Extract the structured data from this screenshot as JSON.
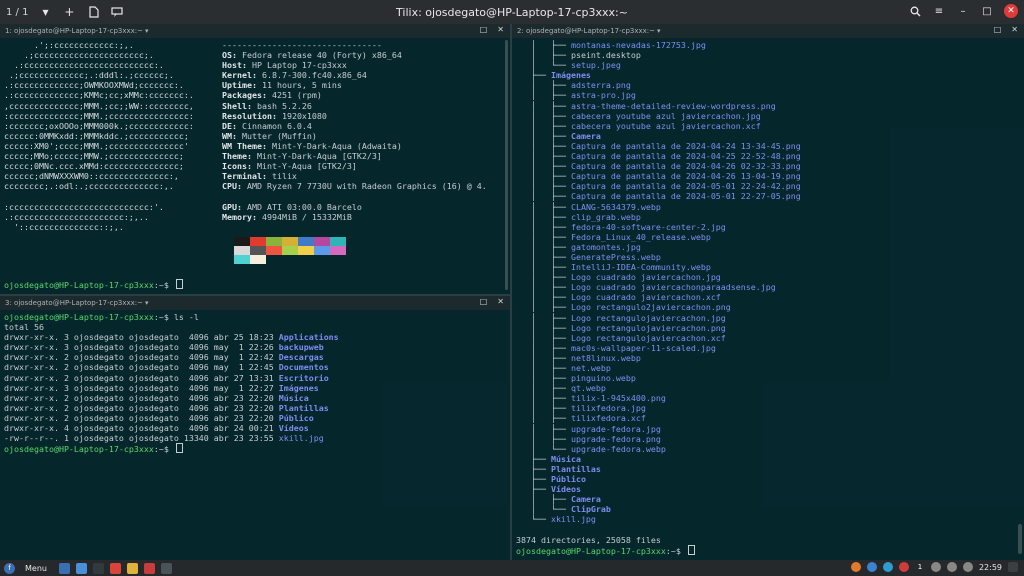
{
  "titlebar": {
    "session": "1 / 1",
    "title": "Tilix: ojosdegato@HP-Laptop-17-cp3xxx:~",
    "icons": [
      "chevron-down-icon",
      "add-terminal-icon",
      "new-session-icon",
      "notification-icon",
      "search-icon",
      "hamburger-menu-icon",
      "minimize-icon",
      "maximize-icon",
      "close-icon"
    ]
  },
  "panes": {
    "top_left": {
      "title": "1: ojosdegato@HP-Laptop-17-cp3xxx:~",
      "logo_lines": [
        "      .';:cccccccccccc:;,.       ",
        "    .;cccccccccccccccccccccc;.   ",
        "  .:cccccccccccccccccccccccccc:. ",
        " .;ccccccccccccc;.:dddl:.;cccccc;.",
        ".:ccccccccccccc;OWMKOOXMWd;ccccccc:.",
        ".:ccccccccccccc;KMMc;cc;xMMc:ccccccc:.",
        ",cccccccccccccc;MMM.;cc;;WW::cccccccc,",
        ":cccccccccccccc;MMM.;cccccccccccccccc:",
        ":ccccccc;oxOOOo;MMM000k.;cccccccccccc:",
        "cccccc:0MMKxdd:;MMMkddc.;ccccccccccc;",
        "ccccc:XM0';cccc;MMM.;ccccccccccccccc'",
        "ccccc;MMo;ccccc;MMW.;cccccccccccccc;",
        "ccccc;0MNc.ccc.xMMd:ccccccccccccccc;",
        "cccccc;dNMWXXXWM0::cccccccccccccc:,",
        "cccccccc;.:odl:.;cccccccccccccc:,.",
        "",
        ":cccccccccccccccccccccccccccc:'.",
        ".:cccccccccccccccccccccc:;,..",
        "  '::cccccccccccccc::;,."
      ],
      "info": [
        {
          "label": "",
          "value": "--------------------------------"
        },
        {
          "label": "OS",
          "value": "Fedora release 40 (Forty) x86_64"
        },
        {
          "label": "Host",
          "value": "HP Laptop 17-cp3xxx"
        },
        {
          "label": "Kernel",
          "value": "6.8.7-300.fc40.x86_64"
        },
        {
          "label": "Uptime",
          "value": "11 hours, 5 mins"
        },
        {
          "label": "Packages",
          "value": "4251 (rpm)"
        },
        {
          "label": "Shell",
          "value": "bash 5.2.26"
        },
        {
          "label": "Resolution",
          "value": "1920x1080"
        },
        {
          "label": "DE",
          "value": "Cinnamon 6.0.4"
        },
        {
          "label": "WM",
          "value": "Mutter (Muffin)"
        },
        {
          "label": "WM Theme",
          "value": "Mint-Y-Dark-Aqua (Adwaita)"
        },
        {
          "label": "Theme",
          "value": "Mint-Y-Dark-Aqua [GTK2/3]"
        },
        {
          "label": "Icons",
          "value": "Mint-Y-Aqua [GTK2/3]"
        },
        {
          "label": "Terminal",
          "value": "tilix"
        },
        {
          "label": "CPU",
          "value": "AMD Ryzen 7 7730U with Radeon Graphics (16) @ 4."
        },
        {
          "label": "",
          "value": ""
        },
        {
          "label": "GPU",
          "value": "AMD ATI 03:00.0 Barcelo"
        },
        {
          "label": "Memory",
          "value": "4994MiB / 15332MiB"
        }
      ],
      "swatch_colors": [
        "#1a1a1a",
        "#e03b2e",
        "#8ab33a",
        "#d6b032",
        "#3e7cc9",
        "#b5479e",
        "#2eb5b5",
        "#d9d9d9",
        "#555555",
        "#f0533f",
        "#a6d04a",
        "#f2cf4b",
        "#5b9bea",
        "#d46ac0",
        "#4fd2d2",
        "#f5f0dc"
      ],
      "prompt_user": "ojosdegato@HP-Laptop-17-cp3xxx",
      "prompt_suffix": ":~$ "
    },
    "bottom_left": {
      "title": "3: ojosdegato@HP-Laptop-17-cp3xxx:~",
      "prompt_user": "ojosdegato@HP-Laptop-17-cp3xxx",
      "prompt_suffix": ":~$ ",
      "command": "ls -l",
      "total": "total 56",
      "rows": [
        {
          "meta": "drwxr-xr-x. 3 ojosdegato ojosdegato  4096 abr 25 18:23 ",
          "name": "Applications",
          "dir": true
        },
        {
          "meta": "drwxr-xr-x. 3 ojosdegato ojosdegato  4096 may  1 22:26 ",
          "name": "backupweb",
          "dir": true
        },
        {
          "meta": "drwxr-xr-x. 2 ojosdegato ojosdegato  4096 may  1 22:42 ",
          "name": "Descargas",
          "dir": true
        },
        {
          "meta": "drwxr-xr-x. 2 ojosdegato ojosdegato  4096 may  1 22:45 ",
          "name": "Documentos",
          "dir": true
        },
        {
          "meta": "drwxr-xr-x. 2 ojosdegato ojosdegato  4096 abr 27 13:31 ",
          "name": "Escritorio",
          "dir": true
        },
        {
          "meta": "drwxr-xr-x. 3 ojosdegato ojosdegato  4096 may  1 22:27 ",
          "name": "Imágenes",
          "dir": true
        },
        {
          "meta": "drwxr-xr-x. 2 ojosdegato ojosdegato  4096 abr 23 22:20 ",
          "name": "Música",
          "dir": true
        },
        {
          "meta": "drwxr-xr-x. 2 ojosdegato ojosdegato  4096 abr 23 22:20 ",
          "name": "Plantillas",
          "dir": true
        },
        {
          "meta": "drwxr-xr-x. 2 ojosdegato ojosdegato  4096 abr 23 22:20 ",
          "name": "Público",
          "dir": true
        },
        {
          "meta": "drwxr-xr-x. 4 ojosdegato ojosdegato  4096 abr 24 00:21 ",
          "name": "Vídeos",
          "dir": true
        },
        {
          "meta": "-rw-r--r--. 1 ojosdegato ojosdegato 13340 abr 23 23:55 ",
          "name": "xkill.jpg",
          "dir": false
        }
      ]
    },
    "right": {
      "title": "2: ojosdegato@HP-Laptop-17-cp3xxx:~",
      "tree": [
        {
          "prefix": "   │   ├── ",
          "name": "montanas-nevadas-172753.jpg",
          "kind": "file"
        },
        {
          "prefix": "   │   ├── ",
          "name": "pseint.desktop",
          "kind": "plain"
        },
        {
          "prefix": "   │   └── ",
          "name": "setup.jpeg",
          "kind": "file"
        },
        {
          "prefix": "   ├── ",
          "name": "Imágenes",
          "kind": "dir"
        },
        {
          "prefix": "   │   ├── ",
          "name": "adsterra.png",
          "kind": "file"
        },
        {
          "prefix": "   │   ├── ",
          "name": "astra-pro.jpg",
          "kind": "file"
        },
        {
          "prefix": "   │   ├── ",
          "name": "astra-theme-detailed-review-wordpress.png",
          "kind": "file"
        },
        {
          "prefix": "   │   ├── ",
          "name": "cabecera youtube azul javiercachon.jpg",
          "kind": "file"
        },
        {
          "prefix": "   │   ├── ",
          "name": "cabecera youtube azul javiercachon.xcf",
          "kind": "file"
        },
        {
          "prefix": "   │   ├── ",
          "name": "Camera",
          "kind": "dir"
        },
        {
          "prefix": "   │   ├── ",
          "name": "Captura de pantalla de 2024-04-24 13-34-45.png",
          "kind": "file"
        },
        {
          "prefix": "   │   ├── ",
          "name": "Captura de pantalla de 2024-04-25 22-52-48.png",
          "kind": "file"
        },
        {
          "prefix": "   │   ├── ",
          "name": "Captura de pantalla de 2024-04-26 02-32-33.png",
          "kind": "file"
        },
        {
          "prefix": "   │   ├── ",
          "name": "Captura de pantalla de 2024-04-26 13-04-19.png",
          "kind": "file"
        },
        {
          "prefix": "   │   ├── ",
          "name": "Captura de pantalla de 2024-05-01 22-24-42.png",
          "kind": "file"
        },
        {
          "prefix": "   │   ├── ",
          "name": "Captura de pantalla de 2024-05-01 22-27-05.png",
          "kind": "file"
        },
        {
          "prefix": "   │   ├── ",
          "name": "CLANG-5634379.webp",
          "kind": "file"
        },
        {
          "prefix": "   │   ├── ",
          "name": "clip_grab.webp",
          "kind": "file"
        },
        {
          "prefix": "   │   ├── ",
          "name": "fedora-40-software-center-2.jpg",
          "kind": "file"
        },
        {
          "prefix": "   │   ├── ",
          "name": "Fedora_Linux_40_release.webp",
          "kind": "file"
        },
        {
          "prefix": "   │   ├── ",
          "name": "gatomontes.jpg",
          "kind": "file"
        },
        {
          "prefix": "   │   ├── ",
          "name": "GeneratePress.webp",
          "kind": "file"
        },
        {
          "prefix": "   │   ├── ",
          "name": "IntelliJ-IDEA-Community.webp",
          "kind": "file"
        },
        {
          "prefix": "   │   ├── ",
          "name": "Logo cuadrado javiercachon.jpg",
          "kind": "file"
        },
        {
          "prefix": "   │   ├── ",
          "name": "Logo cuadrado javiercachonparaadsense.jpg",
          "kind": "file"
        },
        {
          "prefix": "   │   ├── ",
          "name": "Logo cuadrado javiercachon.xcf",
          "kind": "file"
        },
        {
          "prefix": "   │   ├── ",
          "name": "Logo rectangulo2javiercachon.png",
          "kind": "file"
        },
        {
          "prefix": "   │   ├── ",
          "name": "Logo rectangulojaviercachon.jpg",
          "kind": "file"
        },
        {
          "prefix": "   │   ├── ",
          "name": "Logo rectangulojaviercachon.png",
          "kind": "file"
        },
        {
          "prefix": "   │   ├── ",
          "name": "Logo rectangulojaviercachon.xcf",
          "kind": "file"
        },
        {
          "prefix": "   │   ├── ",
          "name": "mac0s-wallpaper-11-scaled.jpg",
          "kind": "file"
        },
        {
          "prefix": "   │   ├── ",
          "name": "net8linux.webp",
          "kind": "file"
        },
        {
          "prefix": "   │   ├── ",
          "name": "net.webp",
          "kind": "file"
        },
        {
          "prefix": "   │   ├── ",
          "name": "pinguino.webp",
          "kind": "file"
        },
        {
          "prefix": "   │   ├── ",
          "name": "qt.webp",
          "kind": "file"
        },
        {
          "prefix": "   │   ├── ",
          "name": "tilix-1-945x400.png",
          "kind": "file"
        },
        {
          "prefix": "   │   ├── ",
          "name": "tilixfedora.jpg",
          "kind": "file"
        },
        {
          "prefix": "   │   ├── ",
          "name": "tilixfedora.xcf",
          "kind": "file"
        },
        {
          "prefix": "   │   ├── ",
          "name": "upgrade-fedora.jpg",
          "kind": "file"
        },
        {
          "prefix": "   │   ├── ",
          "name": "upgrade-fedora.png",
          "kind": "file"
        },
        {
          "prefix": "   │   └── ",
          "name": "upgrade-fedora.webp",
          "kind": "file"
        },
        {
          "prefix": "   ├── ",
          "name": "Música",
          "kind": "dir"
        },
        {
          "prefix": "   ├── ",
          "name": "Plantillas",
          "kind": "dir"
        },
        {
          "prefix": "   ├── ",
          "name": "Público",
          "kind": "dir"
        },
        {
          "prefix": "   ├── ",
          "name": "Vídeos",
          "kind": "dir"
        },
        {
          "prefix": "   │   ├── ",
          "name": "Camera",
          "kind": "dir"
        },
        {
          "prefix": "   │   └── ",
          "name": "ClipGrab",
          "kind": "dir"
        },
        {
          "prefix": "   └── ",
          "name": "xkill.jpg",
          "kind": "file"
        }
      ],
      "summary": "3874 directories, 25058 files",
      "prompt_user": "ojosdegato@HP-Laptop-17-cp3xxx",
      "prompt_suffix": ":~$ "
    }
  },
  "taskbar": {
    "menu_label": "Menu",
    "clock": "22:59",
    "apps": [
      {
        "name": "show-desktop",
        "color": "#3a6fb0"
      },
      {
        "name": "file-manager",
        "color": "#4a90d9"
      },
      {
        "name": "terminal",
        "color": "#333a3f"
      },
      {
        "name": "chrome",
        "color": "#d9453a"
      },
      {
        "name": "text-editor",
        "color": "#e0b43c"
      },
      {
        "name": "screenshot",
        "color": "#c83c3c"
      },
      {
        "name": "tilix",
        "color": "#4a5358"
      }
    ],
    "tray": [
      {
        "name": "updates-icon",
        "color": "#e07b2e"
      },
      {
        "name": "bluetooth-icon",
        "color": "#3b82d1"
      },
      {
        "name": "shield-icon",
        "color": "#2e9bd1"
      },
      {
        "name": "mail-icon",
        "color": "#d03c3c"
      },
      {
        "name": "notification-count",
        "text": "1"
      },
      {
        "name": "network-icon",
        "color": "#888"
      },
      {
        "name": "volume-icon",
        "color": "#888"
      },
      {
        "name": "battery-icon",
        "color": "#888"
      }
    ]
  }
}
